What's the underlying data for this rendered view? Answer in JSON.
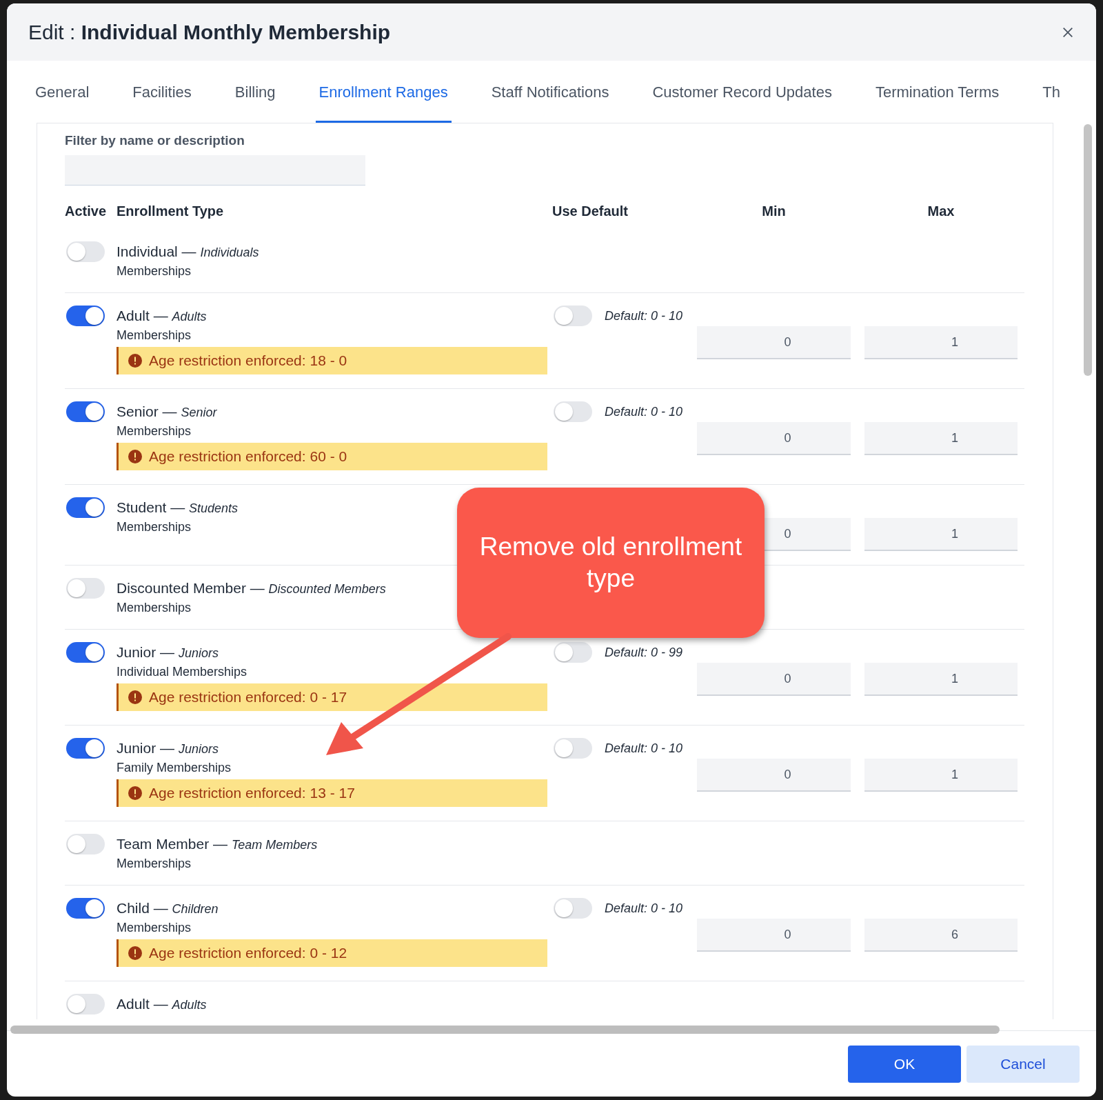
{
  "dialog": {
    "title_prefix": "Edit :",
    "title": "Individual Monthly Membership"
  },
  "tabs": [
    {
      "label": "General",
      "selected": false
    },
    {
      "label": "Facilities",
      "selected": false
    },
    {
      "label": "Billing",
      "selected": false
    },
    {
      "label": "Enrollment Ranges",
      "selected": true
    },
    {
      "label": "Staff Notifications",
      "selected": false
    },
    {
      "label": "Customer Record Updates",
      "selected": false
    },
    {
      "label": "Termination Terms",
      "selected": false
    },
    {
      "label": "Th",
      "selected": false
    }
  ],
  "filter": {
    "label": "Filter by name or description"
  },
  "columns": [
    "Active",
    "Enrollment Type",
    "Use Default",
    "Min",
    "Max"
  ],
  "rows": [
    {
      "label": "Individual — *Individuals*",
      "sub": "Memberships",
      "active": false
    },
    {
      "label": "Adult — *Adults*",
      "sub": "Memberships",
      "active": true,
      "use_default": {
        "on": false,
        "text": "Default: 0 - 10"
      },
      "min": "0",
      "max": "1",
      "warning": "Age restriction enforced: 18 - 0"
    },
    {
      "label": "Senior — *Senior*",
      "sub": "Memberships",
      "active": true,
      "use_default": {
        "on": false,
        "text": "Default: 0 - 10"
      },
      "min": "0",
      "max": "1",
      "warning": "Age restriction enforced: 60 - 0"
    },
    {
      "label": "Student — *Students*",
      "sub": "Memberships",
      "active": true,
      "min": "0",
      "max": "1"
    },
    {
      "label": "Discounted Member — *Discounted Members*",
      "sub": "Memberships",
      "active": false
    },
    {
      "label": "Junior — *Juniors*",
      "sub": "Individual Memberships",
      "active": true,
      "use_default": {
        "on": false,
        "text": "Default: 0 - 99"
      },
      "min": "0",
      "max": "1",
      "warning": "Age restriction enforced: 0 - 17"
    },
    {
      "label": "Junior — *Juniors*",
      "sub": "Family Memberships",
      "active": true,
      "use_default": {
        "on": false,
        "text": "Default: 0 - 10"
      },
      "min": "0",
      "max": "1",
      "warning": "Age restriction enforced: 13 - 17"
    },
    {
      "label": "Team Member — *Team Members*",
      "sub": "Memberships",
      "active": false
    },
    {
      "label": "Child — *Children*",
      "sub": "Memberships",
      "active": true,
      "use_default": {
        "on": false,
        "text": "Default: 0 - 10"
      },
      "min": "0",
      "max": "6",
      "warning": "Age restriction enforced: 0 - 12"
    },
    {
      "label": "Adult — *Adults*",
      "active": false
    }
  ],
  "callout": {
    "text": "Remove old enrollment type"
  },
  "buttons": [
    {
      "label": "OK",
      "kind": "primary"
    },
    {
      "label": "Cancel",
      "kind": "secondary"
    }
  ]
}
